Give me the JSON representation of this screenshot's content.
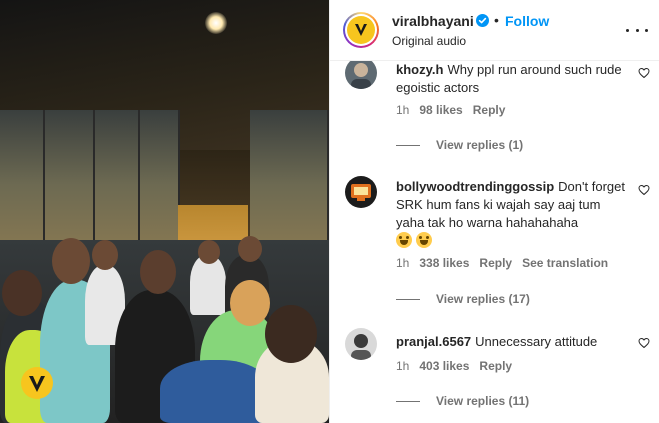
{
  "post": {
    "username": "viralbhayani",
    "follow_label": "Follow",
    "separator": "•",
    "audio_label": "Original audio"
  },
  "media": {
    "watermark_text": "VIRAL BHAYANI"
  },
  "comments": [
    {
      "username": "khozy.h",
      "text": "Why ppl run around such rude egoistic actors",
      "time": "1h",
      "likes": "98 likes",
      "reply_label": "Reply",
      "view_replies": "View replies (1)"
    },
    {
      "username": "bollywoodtrendinggossip",
      "text": "Don't forget SRK hum fans ki wajah say aaj tum yaha tak ho warna hahahahaha",
      "emojis": [
        "😜",
        "😜"
      ],
      "time": "1h",
      "likes": "338 likes",
      "reply_label": "Reply",
      "translate_label": "See translation",
      "view_replies": "View replies (17)"
    },
    {
      "username": "pranjal.6567",
      "text": "Unnecessary attitude",
      "time": "1h",
      "likes": "403 likes",
      "reply_label": "Reply",
      "view_replies": "View replies (11)"
    }
  ],
  "colors": {
    "accent": "#0095f6",
    "secondary_text": "#737373",
    "brand_yellow": "#f7c51e"
  },
  "icons": [
    "verified-badge-icon",
    "more-options-icon",
    "heart-icon",
    "smiley-emoji-icon"
  ]
}
